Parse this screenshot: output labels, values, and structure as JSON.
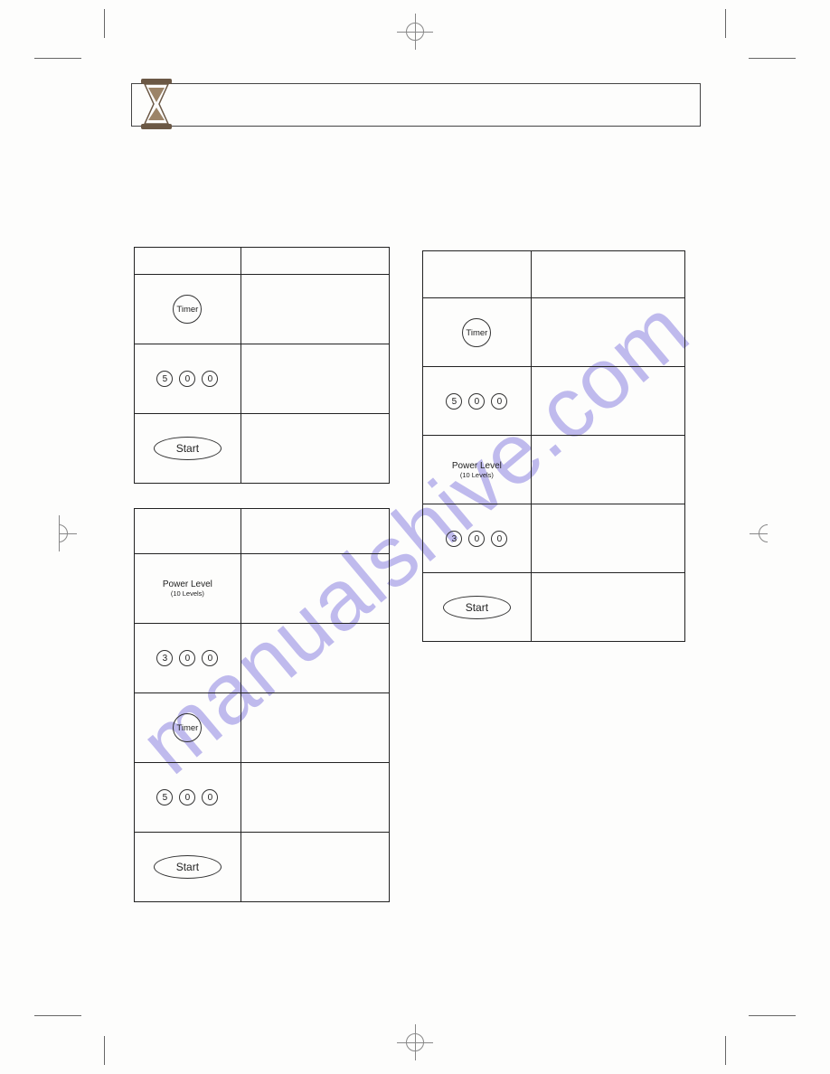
{
  "watermark": "manualshive.com",
  "labels": {
    "timer": "Timer",
    "start": "Start",
    "power": "Power Level",
    "power_sub": "(10 Levels)"
  },
  "table1": {
    "rows": [
      {
        "kind": "timer"
      },
      {
        "kind": "digits",
        "digits": [
          "5",
          "0",
          "0"
        ]
      },
      {
        "kind": "start"
      }
    ]
  },
  "table2": {
    "rows": [
      {
        "kind": "power"
      },
      {
        "kind": "digits",
        "digits": [
          "3",
          "0",
          "0"
        ]
      },
      {
        "kind": "timer"
      },
      {
        "kind": "digits",
        "digits": [
          "5",
          "0",
          "0"
        ]
      },
      {
        "kind": "start"
      }
    ]
  },
  "table3": {
    "rows": [
      {
        "kind": "timer"
      },
      {
        "kind": "digits",
        "digits": [
          "5",
          "0",
          "0"
        ]
      },
      {
        "kind": "power"
      },
      {
        "kind": "digits",
        "digits": [
          "3",
          "0",
          "0"
        ]
      },
      {
        "kind": "start"
      }
    ]
  }
}
